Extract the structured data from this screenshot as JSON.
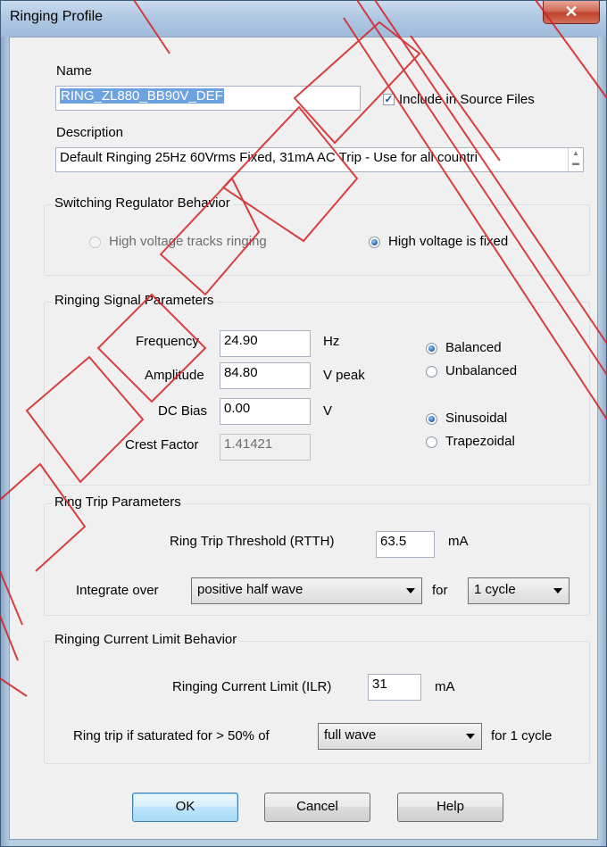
{
  "window": {
    "title": "Ringing Profile",
    "close_glyph": "✕"
  },
  "name": {
    "label": "Name",
    "value": "RING_ZL880_BB90V_DEF"
  },
  "include": {
    "label": "Include in Source Files",
    "checked": true
  },
  "description": {
    "label": "Description",
    "value": "Default Ringing 25Hz 60Vrms Fixed, 31mA AC Trip - Use for all countri"
  },
  "switching": {
    "title": "Switching Regulator Behavior",
    "opt_tracks": "High voltage tracks ringing",
    "opt_fixed": "High voltage is fixed"
  },
  "signal": {
    "title": "Ringing Signal Parameters",
    "frequency_label": "Frequency",
    "frequency_value": "24.90",
    "frequency_unit": "Hz",
    "amplitude_label": "Amplitude",
    "amplitude_value": "84.80",
    "amplitude_unit": "V peak",
    "dcbias_label": "DC Bias",
    "dcbias_value": "0.00",
    "dcbias_unit": "V",
    "crest_label": "Crest Factor",
    "crest_value": "1.41421",
    "opt_balanced": "Balanced",
    "opt_unbalanced": "Unbalanced",
    "opt_sinusoidal": "Sinusoidal",
    "opt_trapezoidal": "Trapezoidal"
  },
  "trip": {
    "title": "Ring Trip Parameters",
    "threshold_label": "Ring Trip Threshold (RTTH)",
    "threshold_value": "63.5",
    "threshold_unit": "mA",
    "integrate_label": "Integrate over",
    "integrate_value": "positive half wave",
    "for_label": "for",
    "cycles_value": "1 cycle"
  },
  "limit": {
    "title": "Ringing Current Limit Behavior",
    "ilr_label": "Ringing Current Limit (ILR)",
    "ilr_value": "31",
    "ilr_unit": "mA",
    "saturated_label": "Ring trip if saturated for > 50% of",
    "wave_value": "full wave",
    "for_cycle_label": "for 1 cycle"
  },
  "buttons": {
    "ok": "OK",
    "cancel": "Cancel",
    "help": "Help"
  },
  "watermark": {
    "text": "CONFIDENTIAL",
    "color": "#d42020"
  }
}
